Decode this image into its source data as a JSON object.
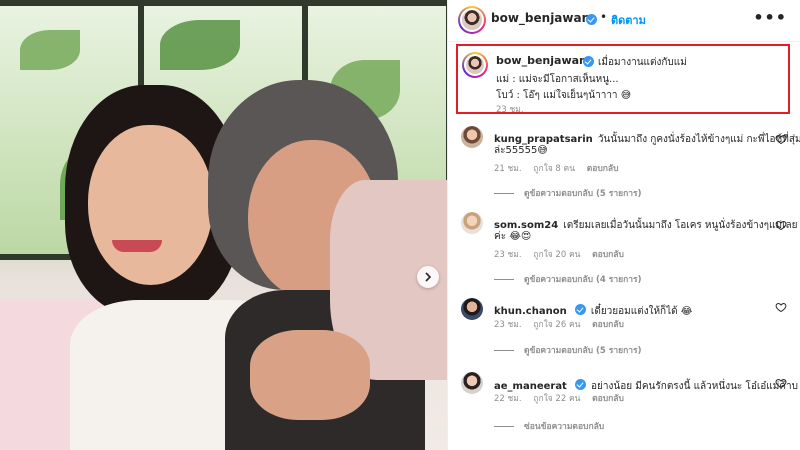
{
  "header": {
    "username": "bow_benjawan",
    "dot": "•",
    "follow_label": "ติดตาม",
    "more_icon": "more-horizontal-icon"
  },
  "caption": {
    "username": "bow_benjawan",
    "line1": "เมื่อมางานแต่งกับแม่",
    "line2": "แม่ : แม่จะมีโอกาสเห็นหนู...",
    "line3": "โบว์ : โอ๊ๆ แม่ใจเย็นๆน้าาาา 😅",
    "time": "23 ชม.",
    "highlight_color": "#e31c25"
  },
  "comments": [
    {
      "username": "kung_prapatsarin",
      "text1": "วันนั้นมาถึง กูคงนั่งร้องไห้ข้างๆแม่ กะพี่ไอซ์ที่สุ่ม",
      "text2": "ล่ะ55555😅",
      "time": "21 ชม.",
      "likes": "ถูกใจ 8 คน",
      "reply": "ตอบกลับ",
      "view_replies": "ดูข้อความตอบกลับ (5 รายการ)"
    },
    {
      "username": "som.som24",
      "text1": "เตรียมเลยเมื่อวันนั้นมาถึง โอเคร หนูนั่งร้องข้างๆแม่เลย",
      "text2": "ค่ะ 😂😍",
      "time": "23 ชม.",
      "likes": "ถูกใจ 20 คน",
      "reply": "ตอบกลับ",
      "view_replies": "ดูข้อความตอบกลับ (4 รายการ)"
    },
    {
      "username": "khun.chanon",
      "text1": "เดี๋ยวยอมแต่งให้ก็ได้ 😂",
      "text2": "",
      "time": "23 ชม.",
      "likes": "ถูกใจ 26 คน",
      "reply": "ตอบกลับ",
      "view_replies": "ดูข้อความตอบกลับ (5 รายการ)"
    },
    {
      "username": "ae_maneerat",
      "text1": "อย่างน้อย มีคนรักตรงนี้ แล้วหนึ่งนะ โอ๋เอ๋แม่ค้าบ",
      "text2": "",
      "time": "22 ชม.",
      "likes": "ถูกใจ 22 คน",
      "reply": "ตอบกลับ",
      "view_replies": "ซ่อนข้อความตอบกลับ"
    }
  ],
  "colors": {
    "link_blue": "#0095f6",
    "verified_blue": "#3897f0",
    "meta_gray": "#8e8e8e"
  },
  "icons": {
    "verified": "verified-badge-icon",
    "like": "heart-icon",
    "carousel_next": "chevron-right-icon"
  }
}
